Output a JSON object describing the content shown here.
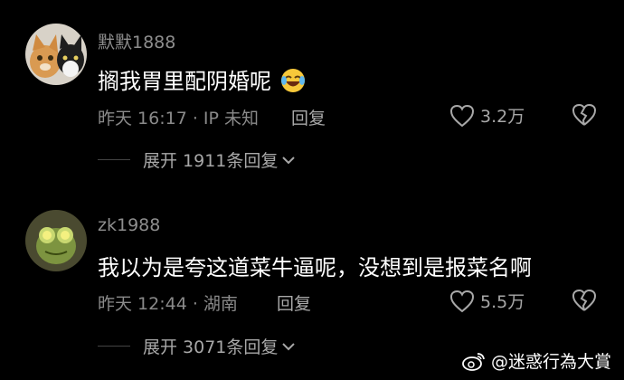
{
  "comments": [
    {
      "username": "默默1888",
      "text": "搁我胃里配阴婚呢",
      "time_location": "昨天 16:17 · IP 未知",
      "reply_label": "回复",
      "like_count": "3.2万",
      "expand_replies": "展开 1911条回复"
    },
    {
      "username": "zk1988",
      "text": "我以为是夸这道菜牛逼呢，没想到是报菜名啊",
      "time_location": "昨天 12:44 · 湖南",
      "reply_label": "回复",
      "like_count": "5.5万",
      "expand_replies": "展开 3071条回复"
    }
  ],
  "watermark": "@迷惑行為大賞",
  "icons": [
    "heart-outline-icon",
    "broken-heart-icon",
    "chevron-down-icon",
    "laughing-emoji-icon",
    "weibo-logo-icon"
  ]
}
